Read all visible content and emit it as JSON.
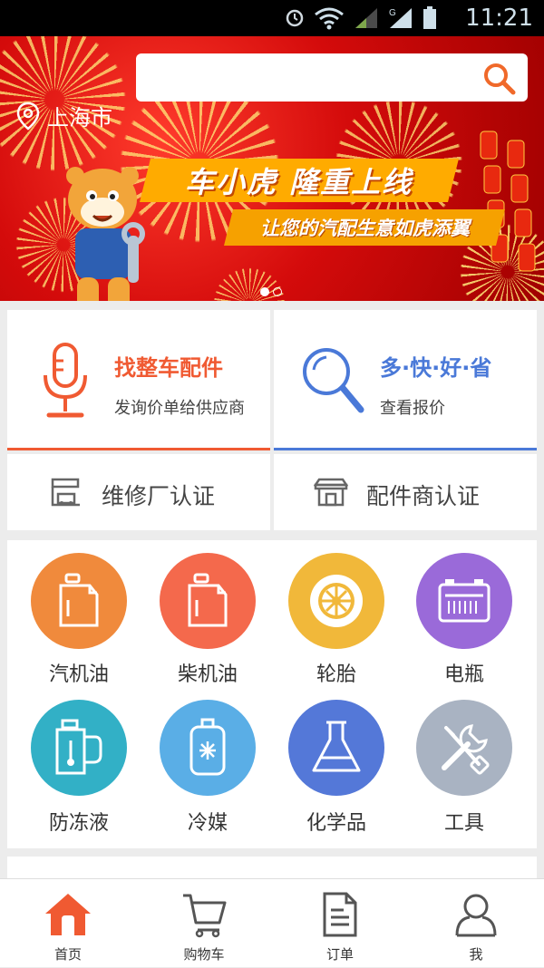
{
  "status_bar": {
    "time": "11:21"
  },
  "header": {
    "city": "上海市",
    "search_placeholder": ""
  },
  "banner": {
    "title": "车小虎  隆重上线",
    "subtitle": "让您的汽配生意如虎添翼",
    "page_count": 2,
    "active_page": 1
  },
  "quick_actions": [
    {
      "title": "找整车配件",
      "desc": "发询价单给供应商",
      "color": "#f05a32",
      "icon": "microphone-icon"
    },
    {
      "title": "多·快·好·省",
      "desc": "查看报价",
      "color": "#4a79d8",
      "icon": "magnifier-icon"
    }
  ],
  "certifications": [
    {
      "label": "维修厂认证",
      "icon": "repair-shop-icon"
    },
    {
      "label": "配件商认证",
      "icon": "parts-store-icon"
    }
  ],
  "categories": [
    {
      "label": "汽机油",
      "color": "#f08a3c",
      "icon": "oil-can-icon"
    },
    {
      "label": "柴机油",
      "color": "#f4694c",
      "icon": "oil-can-icon"
    },
    {
      "label": "轮胎",
      "color": "#f1b83a",
      "icon": "tire-icon"
    },
    {
      "label": "电瓶",
      "color": "#9a6ad9",
      "icon": "battery-icon"
    },
    {
      "label": "防冻液",
      "color": "#32b0c6",
      "icon": "coolant-icon"
    },
    {
      "label": "冷媒",
      "color": "#5aaee6",
      "icon": "refrigerant-icon"
    },
    {
      "label": "化学品",
      "color": "#5478d8",
      "icon": "flask-icon"
    },
    {
      "label": "工具",
      "color": "#a9b3c2",
      "icon": "tools-icon"
    }
  ],
  "tabbar": [
    {
      "label": "首页",
      "icon": "home-icon",
      "active": true
    },
    {
      "label": "购物车",
      "icon": "cart-icon",
      "active": false
    },
    {
      "label": "订单",
      "icon": "order-icon",
      "active": false
    },
    {
      "label": "我",
      "icon": "user-icon",
      "active": false
    }
  ]
}
